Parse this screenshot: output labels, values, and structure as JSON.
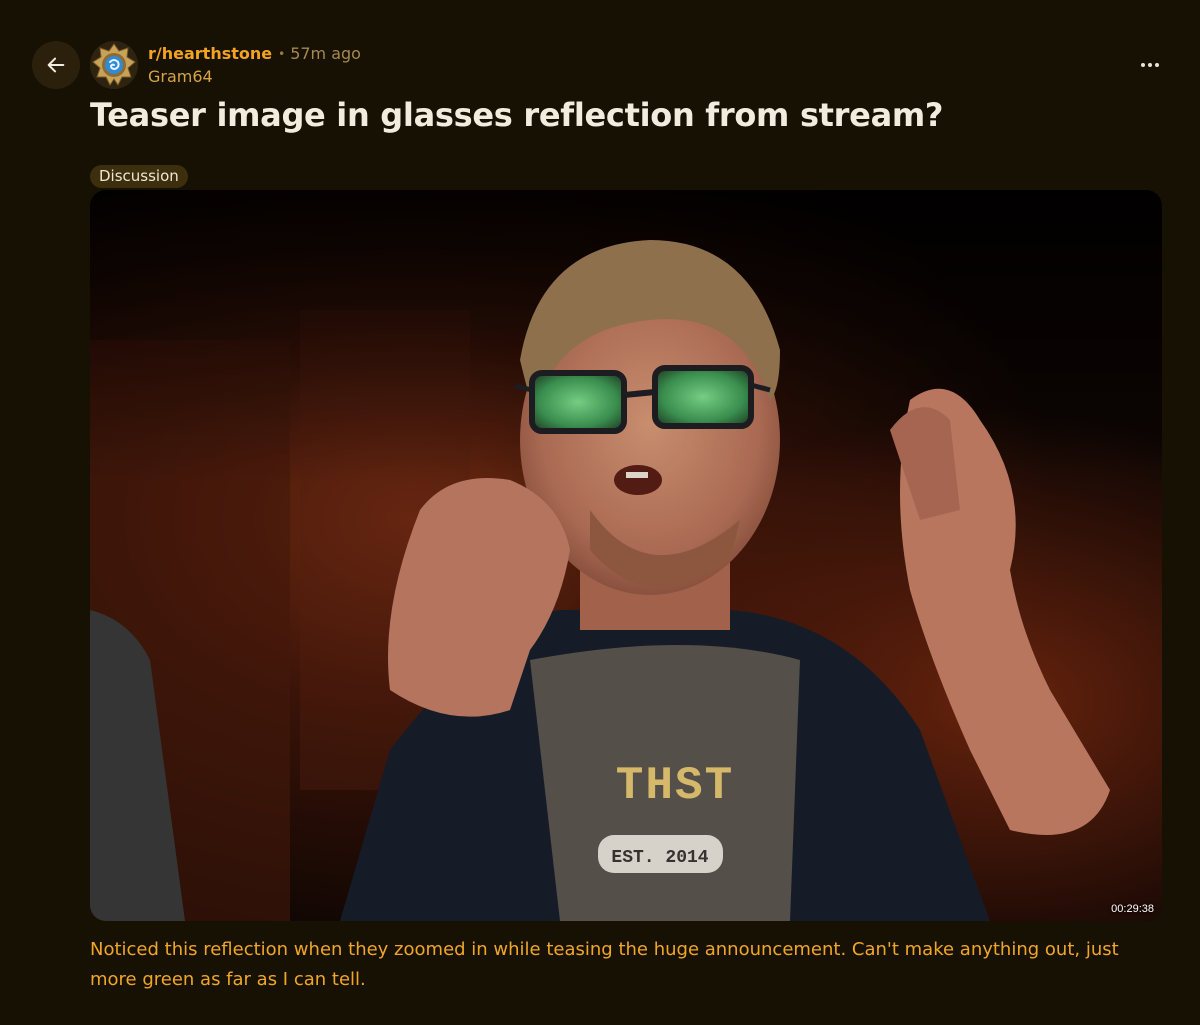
{
  "header": {
    "back_icon": "arrow-left-icon",
    "subreddit": "r/hearthstone",
    "separator": "•",
    "time_ago": "57m ago",
    "author": "Gram64",
    "overflow_icon": "more-horizontal-icon"
  },
  "post": {
    "title": "Teaser image in glasses reflection from stream?",
    "flair": "Discussion",
    "media": {
      "timestamp": "00:29:38",
      "shirt_text": "THST",
      "shirt_badge": "EST. 2014"
    },
    "body": "Noticed this reflection when they zoomed in while teasing the huge announcement. Can't make anything out, just more green as far as I can tell."
  },
  "colors": {
    "background": "#171104",
    "accent": "#f3a320",
    "body_text": "#f0a628",
    "title_text": "#f2ecdf",
    "flair_bg": "#3d2e0e"
  }
}
